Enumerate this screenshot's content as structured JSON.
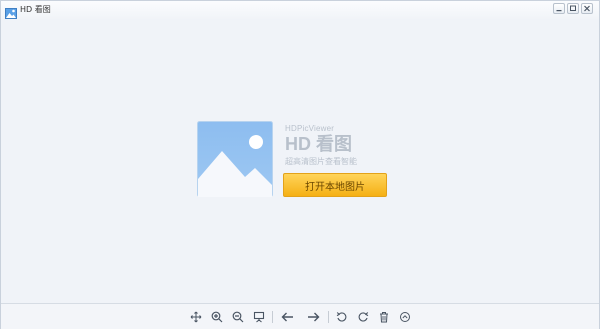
{
  "window": {
    "title": "HD 看图",
    "controls": [
      "minimize-icon",
      "restore-icon",
      "close-icon"
    ]
  },
  "welcome": {
    "brand_small": "HDPicViewer",
    "brand_big": "HD 看图",
    "tagline": "超高清图片查看智能",
    "open_button_label": "打开本地图片"
  },
  "toolbar": {
    "tools": [
      "move-icon",
      "zoom-in-icon",
      "zoom-out-icon",
      "slideshow-icon",
      "previous-arrow-icon",
      "next-arrow-icon",
      "rotate-left-icon",
      "rotate-right-icon",
      "delete-icon",
      "more-icon"
    ]
  },
  "colors": {
    "accent_button": "#f5b015",
    "placeholder_blue": "#8fbfee",
    "background": "#f0f3f8"
  }
}
